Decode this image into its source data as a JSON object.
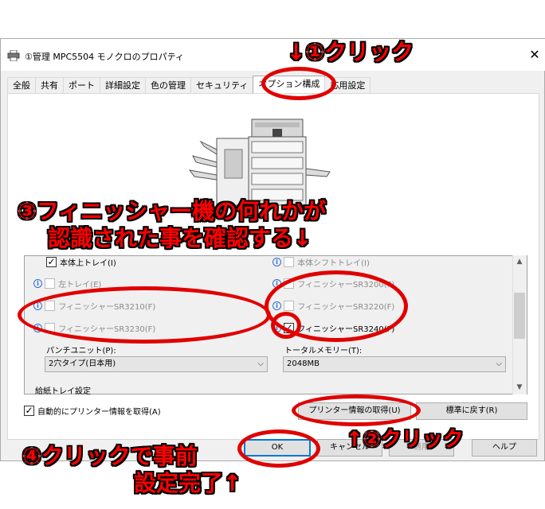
{
  "window": {
    "title": "①管理 MPC5504 モノクロのプロパティ",
    "close_label": "✕"
  },
  "tabs": [
    {
      "label": "全般"
    },
    {
      "label": "共有"
    },
    {
      "label": "ポート"
    },
    {
      "label": "詳細設定"
    },
    {
      "label": "色の管理"
    },
    {
      "label": "セキュリティ"
    },
    {
      "label": "オプション構成"
    },
    {
      "label": "応用設定"
    }
  ],
  "options": {
    "main_upper_tray": "本体上トレイ(I)",
    "main_shift_tray": "本体シフトトレイ(I)",
    "left_tray": "左トレイ(E)",
    "sr3200": "フィニッシャーSR3200(F)",
    "sr3210": "フィニッシャーSR3210(F)",
    "sr3220": "フィニッシャーSR3220(F)",
    "sr3230": "フィニッシャーSR3230(F)",
    "sr3240": "フィニッシャーSR3240(F)",
    "punch_unit_label": "パンチユニット(P):",
    "punch_unit_value": "2穴タイプ(日本用)",
    "total_memory_label": "トータルメモリー(T):",
    "total_memory_value": "2048MB",
    "paper_tray_label": "給紙トレイ設定"
  },
  "footer": {
    "auto_get_label": "自動的にプリンター情報を取得(A)",
    "get_info_button": "プリンター情報の取得(U)",
    "reset_button": "標準に戻す(R)",
    "ok_button": "OK",
    "cancel_button": "キャンセル",
    "apply_button": "適用",
    "help_button": "ヘルプ"
  },
  "annotations": {
    "step1": "↓①クリック",
    "step3_line1": "③フィニッシャー機の何れかが",
    "step3_line2": "認識された事を確認する↓",
    "step2": "↑②クリック",
    "step4_line1": "④クリックで事前",
    "step4_line2": "設定完了↑"
  },
  "colors": {
    "annotation_red": "#ff0000",
    "annotation_outline": "#000000",
    "focus_blue": "#0078d7"
  }
}
